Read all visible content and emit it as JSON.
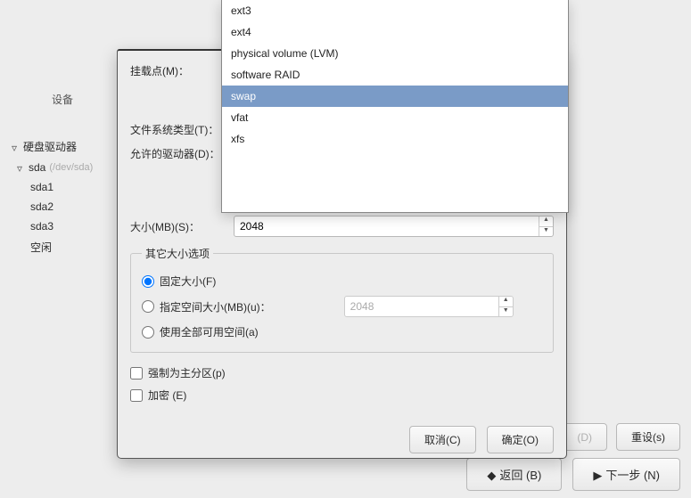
{
  "tree": {
    "header": "设备",
    "hard_drives": "硬盘驱动器",
    "sda": "sda",
    "sda_path": "(/dev/sda)",
    "sda1": "sda1",
    "sda2": "sda2",
    "sda3": "sda3",
    "free": "空闲"
  },
  "bg_buttons": {
    "d": "(D)",
    "reset": "重设(s)",
    "back": "返回 (B)",
    "next": "下一步 (N)"
  },
  "dialog": {
    "mount_label": "挂载点(M)：",
    "fstype_label": "文件系统类型(T)：",
    "drives_label": "允许的驱动器(D)：",
    "size_label": "大小(MB)(S)：",
    "size_value": "2048",
    "size_opts_legend": "其它大小选项",
    "fixed": "固定大小(F)",
    "fillto": "指定空间大小(MB)(u)：",
    "fillto_value": "2048",
    "fillmax": "使用全部可用空间(a)",
    "primary": "强制为主分区(p)",
    "encrypt": "加密 (E)",
    "cancel": "取消(C)",
    "ok": "确定(O)"
  },
  "dropdown": {
    "ext3": "ext3",
    "ext4": "ext4",
    "pv": "physical volume (LVM)",
    "raid": "software RAID",
    "swap": "swap",
    "vfat": "vfat",
    "xfs": "xfs"
  }
}
